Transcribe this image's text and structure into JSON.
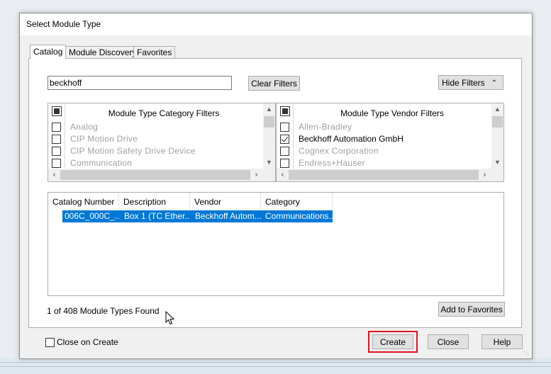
{
  "window": {
    "title": "Select Module Type"
  },
  "tabs": [
    {
      "label": "Catalog",
      "active": true
    },
    {
      "label": "Module Discovery",
      "active": false
    },
    {
      "label": "Favorites",
      "active": false
    }
  ],
  "search": {
    "value": "beckhoff"
  },
  "buttons": {
    "clear_filters": "Clear Filters",
    "hide_filters": "Hide Filters",
    "add_to_favorites": "Add to Favorites",
    "create": "Create",
    "close": "Close",
    "help": "Help"
  },
  "category_filters": {
    "title": "Module Type Category Filters",
    "items": [
      {
        "label": "Analog",
        "checked": false
      },
      {
        "label": "CIP Motion Drive",
        "checked": false
      },
      {
        "label": "CIP Motion Safety Drive Device",
        "checked": false
      },
      {
        "label": "Communication",
        "checked": false
      }
    ]
  },
  "vendor_filters": {
    "title": "Module Type Vendor Filters",
    "items": [
      {
        "label": "Allen-Bradley",
        "checked": false
      },
      {
        "label": "Beckhoff Automation GmbH",
        "checked": true
      },
      {
        "label": "Cognex Corporation",
        "checked": false
      },
      {
        "label": "Endress+Hauser",
        "checked": false
      }
    ]
  },
  "results": {
    "columns": [
      "Catalog Number",
      "Description",
      "Vendor",
      "Category"
    ],
    "rows": [
      [
        "006C_000C_...",
        "Box 1 (TC Ether...",
        "Beckhoff Autom...",
        "Communications..."
      ]
    ]
  },
  "status_text": "1  of 408 Module Types Found",
  "footer": {
    "close_on_create_label": "Close on Create",
    "close_on_create_checked": false
  },
  "colors": {
    "selection": "#0078d7",
    "highlight_box": "#e0141d"
  }
}
